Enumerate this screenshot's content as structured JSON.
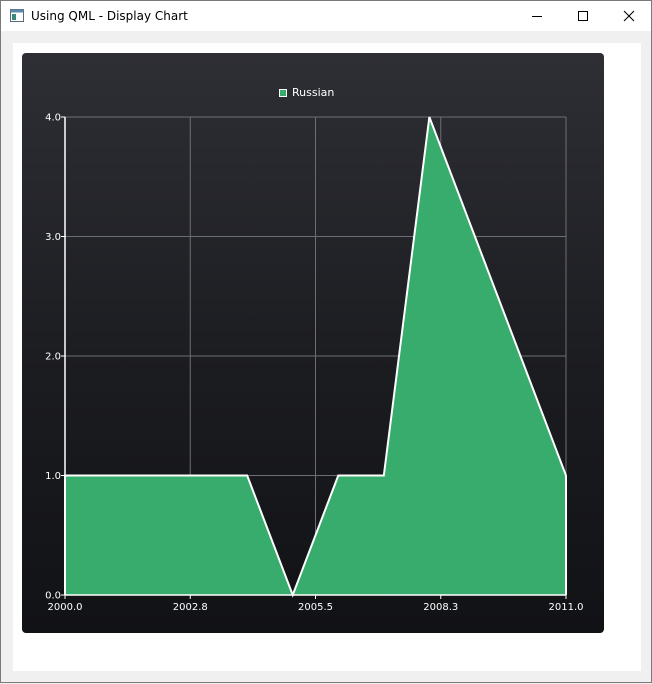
{
  "window": {
    "title": "Using QML - Display Chart",
    "icon": "app-window-icon",
    "controls": [
      "minimize-icon",
      "maximize-icon",
      "close-icon"
    ]
  },
  "colors": {
    "series_fill": "#38ac6c",
    "series_line": "#ffffff",
    "chart_background_top": "#2e2f35",
    "chart_background_bottom": "#111215",
    "grid": "#6e6e72",
    "text": "#ffffff"
  },
  "chart_data": {
    "type": "area",
    "title": "",
    "xlabel": "",
    "ylabel": "",
    "legend": {
      "placement": "top-center",
      "entries": [
        "Russian"
      ]
    },
    "grid": true,
    "xlim": [
      2000.0,
      2011.0
    ],
    "ylim": [
      0.0,
      4.0
    ],
    "x_ticks": [
      "2000.0",
      "2002.8",
      "2005.5",
      "2008.3",
      "2011.0"
    ],
    "y_ticks": [
      "0.0",
      "1.0",
      "2.0",
      "3.0",
      "4.0"
    ],
    "series": [
      {
        "name": "Russian",
        "x": [
          2000,
          2001,
          2002,
          2003,
          2004,
          2005,
          2006,
          2007,
          2008,
          2009,
          2010,
          2011
        ],
        "y": [
          1,
          1,
          1,
          1,
          1,
          0,
          1,
          1,
          4,
          3,
          2,
          1
        ]
      }
    ]
  }
}
